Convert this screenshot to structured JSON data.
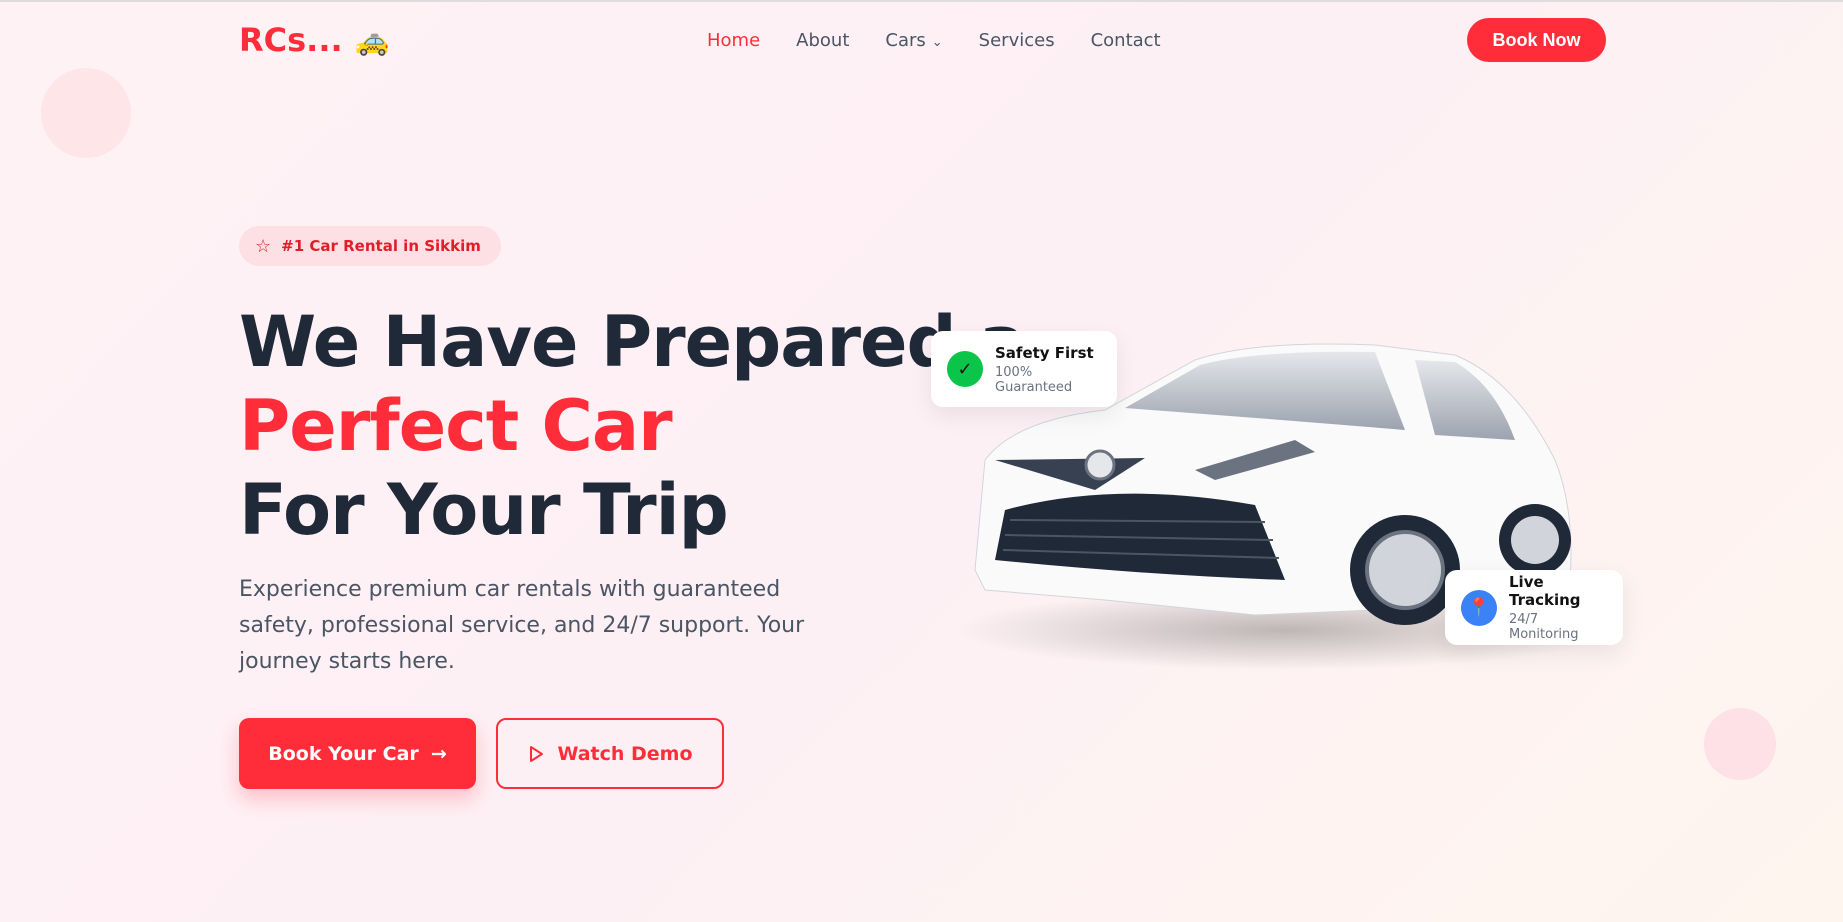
{
  "brand": {
    "name": "RCs...",
    "emoji": "🚕"
  },
  "nav": {
    "items": [
      {
        "label": "Home",
        "active": true
      },
      {
        "label": "About"
      },
      {
        "label": "Cars",
        "dropdown": true
      },
      {
        "label": "Services"
      },
      {
        "label": "Contact"
      }
    ],
    "cta": "Book Now"
  },
  "hero": {
    "badge": "#1 Car Rental in Sikkim",
    "title_line1": "We Have Prepared a",
    "title_highlight": "Perfect Car",
    "title_line3": "For Your Trip",
    "description": "Experience premium car rentals with guaranteed safety, professional service, and 24/7 support. Your journey starts here.",
    "primary_button": "Book Your Car",
    "secondary_button": "Watch Demo"
  },
  "cards": [
    {
      "title": "Safety First",
      "subtitle": "100% Guaranteed",
      "icon": "check-icon"
    },
    {
      "title": "Live Tracking",
      "subtitle": "24/7 Monitoring",
      "icon": "pin-icon"
    }
  ],
  "colors": {
    "accent": "#ff2d3a",
    "text": "#1f2937",
    "safety": "#0bc44a",
    "tracking": "#3b82f6"
  }
}
